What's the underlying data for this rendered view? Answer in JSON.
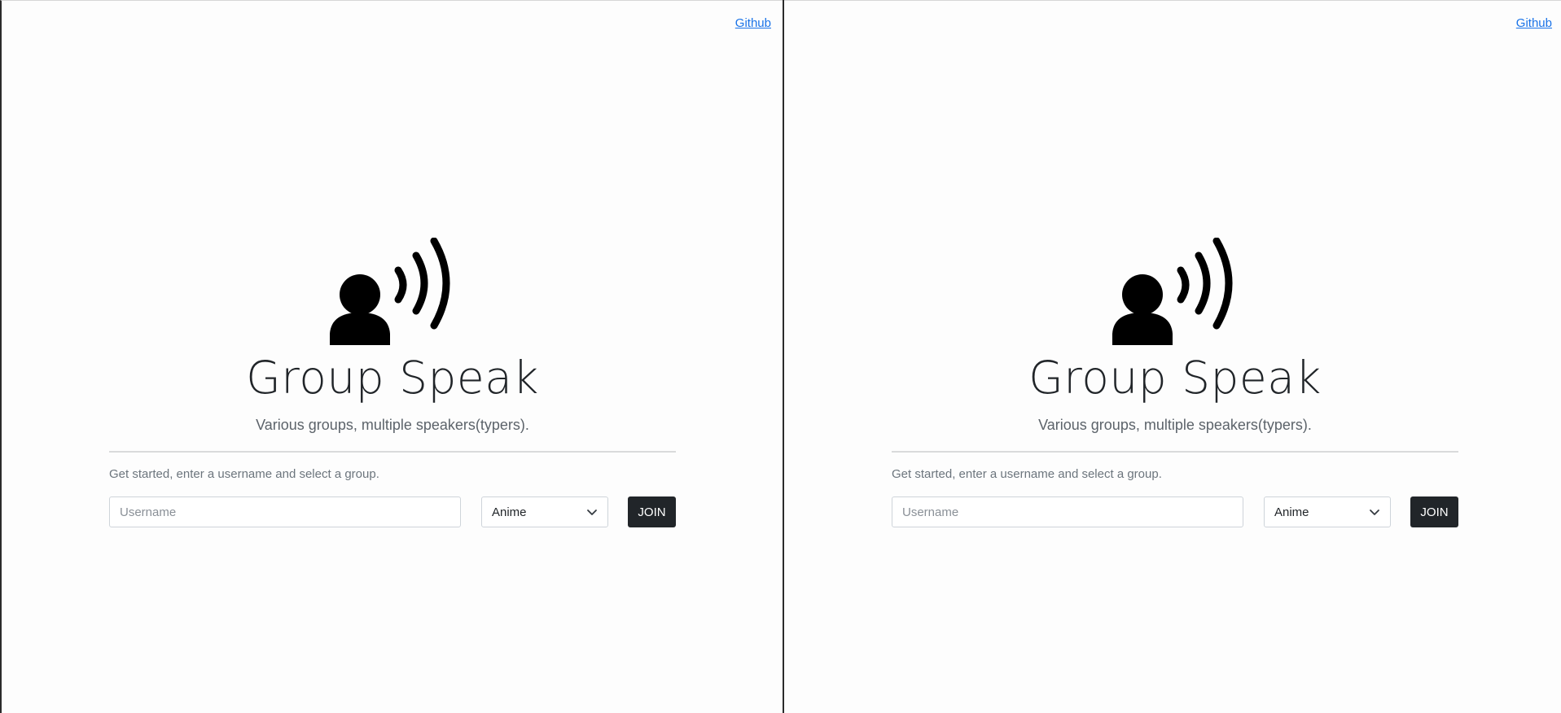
{
  "app": {
    "github_link": "Github",
    "title": "Group Speak",
    "subtitle": "Various groups, multiple speakers(typers).",
    "hint": "Get started, enter a username and select a group.",
    "username_placeholder": "Username",
    "username_value": "",
    "selected_group": "Anime",
    "join_label": "JOIN",
    "logo_icon": "person-speaking-icon"
  },
  "colors": {
    "link": "#1a73e8",
    "button_bg": "#212529",
    "text": "#212529",
    "muted": "#6c757d"
  }
}
